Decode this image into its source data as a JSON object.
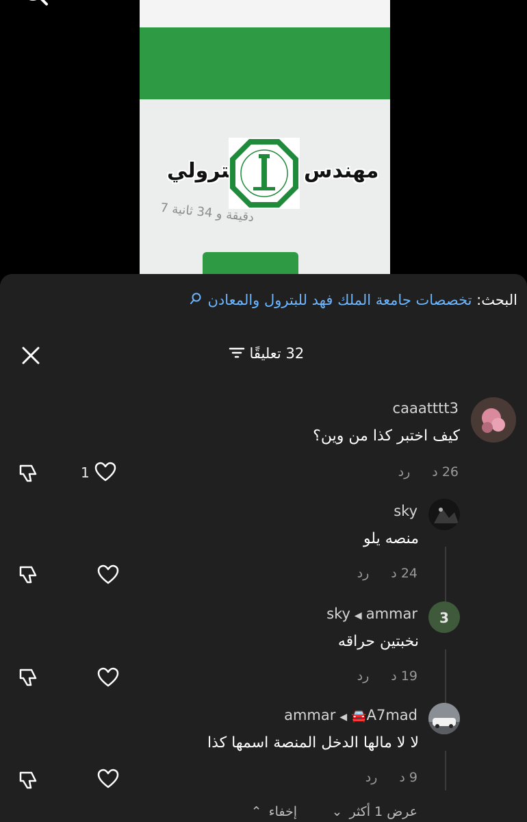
{
  "video": {
    "overlay_left": "بترولي",
    "overlay_right": "مهندس",
    "blurred_text": "7 دقيقة و 34 ثانية"
  },
  "search": {
    "label": "البحث:",
    "query": "تخصصات جامعة الملك فهد للبترول والمعادن"
  },
  "header": {
    "count_label": "32 تعليقًا"
  },
  "comments": [
    {
      "username": "caaatttt3",
      "text": "كيف اختبر كذا من وين؟",
      "time": "26 د",
      "reply": "رد",
      "likes": "1"
    },
    {
      "username": "sky",
      "text": "منصه يلو",
      "time": "24 د",
      "reply": "رد",
      "likes": ""
    },
    {
      "username": "ammar",
      "reply_to": "sky",
      "text": "نخبتين حراقه",
      "time": "19 د",
      "reply": "رد",
      "likes": ""
    },
    {
      "username": "A7mad",
      "reply_to": "ammar",
      "text": "لا لا مالها الدخل المنصة اسمها كذا",
      "time": "9 د",
      "reply": "رد",
      "likes": ""
    }
  ],
  "footer": {
    "view_more": "عرض 1 أكثر",
    "hide": "إخفاء"
  },
  "colors": {
    "sheet_bg": "#202021",
    "link_blue": "#6bb6ff",
    "video_green": "#2f9a44"
  }
}
